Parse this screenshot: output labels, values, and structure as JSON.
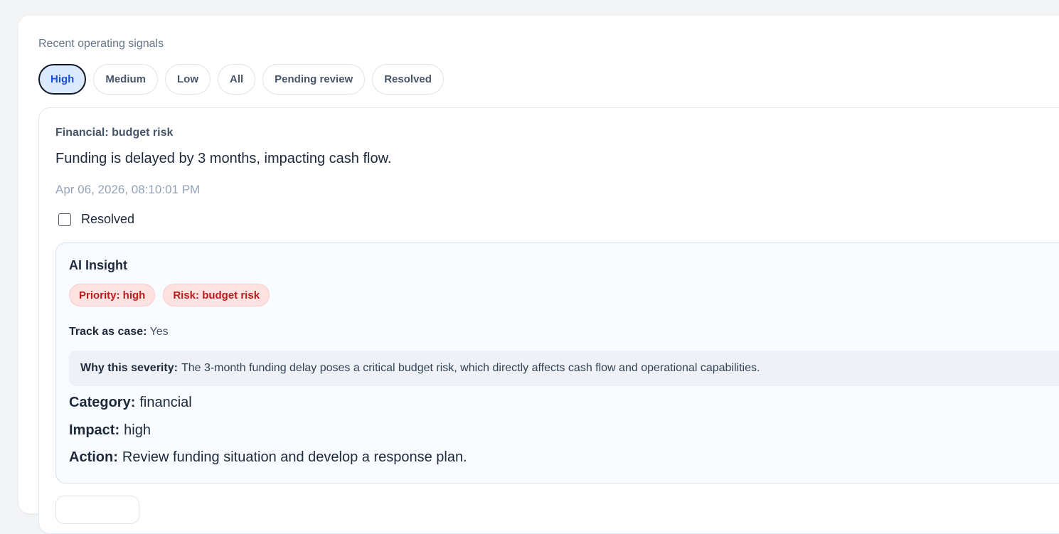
{
  "section_title": "Recent operating signals",
  "filters": [
    {
      "label": "High",
      "active": true
    },
    {
      "label": "Medium",
      "active": false
    },
    {
      "label": "Low",
      "active": false
    },
    {
      "label": "All",
      "active": false
    },
    {
      "label": "Pending review",
      "active": false
    },
    {
      "label": "Resolved",
      "active": false
    }
  ],
  "signal": {
    "category": "Financial: budget risk",
    "message": "Funding is delayed by 3 months, impacting cash flow.",
    "timestamp": "Apr 06, 2026, 08:10:01 PM",
    "resolved_label": "Resolved",
    "resolved_checked": false,
    "insight": {
      "title": "AI Insight",
      "badges": [
        "Priority: high",
        "Risk: budget risk"
      ],
      "track_label": "Track as case:",
      "track_value": "Yes",
      "why_label": "Why this severity:",
      "why_text": "The 3-month funding delay poses a critical budget risk, which directly affects cash flow and operational capabilities.",
      "category_label": "Category:",
      "category_value": "financial",
      "impact_label": "Impact:",
      "impact_value": "high",
      "action_label": "Action:",
      "action_value": "Review funding situation and develop a response plan."
    }
  },
  "colors": {
    "accent": "#1d4ed8",
    "danger": "#b91c1c",
    "danger_bg": "#fee2e2"
  }
}
